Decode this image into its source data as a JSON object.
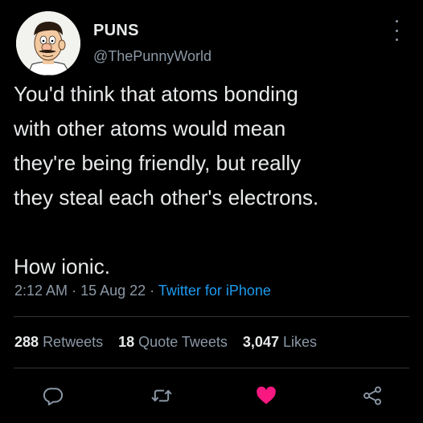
{
  "author": {
    "display_name": "PUNS",
    "handle": "@ThePunnyWorld",
    "avatar_icon": "bob-belcher-avatar"
  },
  "tweet": {
    "text": "You'd think that atoms bonding\nwith other atoms would mean\nthey're being friendly, but really\nthey steal each other's electrons.\n\nHow ionic.",
    "time": "2:12 AM",
    "date": "15 Aug 22",
    "source": "Twitter for iPhone"
  },
  "stats": {
    "retweets_count": "288",
    "retweets_label": "Retweets",
    "quotes_count": "18",
    "quotes_label": "Quote Tweets",
    "likes_count": "3,047",
    "likes_label": "Likes"
  },
  "actions": {
    "reply_icon": "reply-icon",
    "retweet_icon": "retweet-icon",
    "like_icon": "heart-icon",
    "share_icon": "share-icon",
    "liked": true,
    "like_color": "#f91880"
  },
  "colors": {
    "background": "#000000",
    "text": "#e7e9ea",
    "secondary": "#8b98a5",
    "link": "#1d9bf0"
  }
}
